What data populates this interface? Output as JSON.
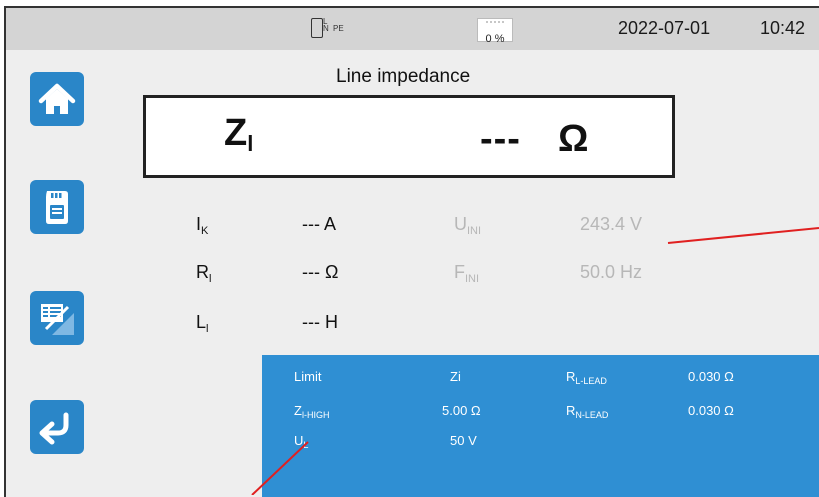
{
  "status_bar": {
    "socket_icon": "socket-l-n-pe-icon",
    "socket_letters": [
      "L",
      "N"
    ],
    "socket_pe": "PE",
    "battery_icon": "battery-icon",
    "battery_level": "0 %",
    "date": "2022-07-01",
    "time": "10:42"
  },
  "nav": {
    "home_icon": "home-icon",
    "memory_icon": "sd-card-icon",
    "report_icon": "report-icon",
    "back_icon": "back-arrow-icon"
  },
  "main": {
    "title": "Line impedance",
    "result": {
      "symbol": "Z",
      "symbol_sub": "l",
      "value": "---",
      "unit": "Ω"
    },
    "measurements": [
      {
        "symbol": "I",
        "sub": "K",
        "value": "--- A"
      },
      {
        "symbol": "R",
        "sub": "l",
        "value": "--- Ω"
      },
      {
        "symbol": "L",
        "sub": "l",
        "value": "--- H"
      }
    ],
    "initial": [
      {
        "symbol": "U",
        "sub": "INI",
        "value": "243.4 V"
      },
      {
        "symbol": "F",
        "sub": "INI",
        "value": "50.0 Hz"
      }
    ]
  },
  "limits": {
    "row1": {
      "label": "Limit",
      "value": "Zi",
      "rlabel": "R",
      "rsub": "L-LEAD",
      "rvalue": "0.030 Ω"
    },
    "row2": {
      "label": "Z",
      "label_sub": "l-HIGH",
      "value": "5.00 Ω",
      "rlabel": "R",
      "rsub": "N-LEAD",
      "rvalue": "0.030 Ω"
    },
    "row3": {
      "label": "U",
      "label_sub": "L",
      "value": "50 V"
    }
  },
  "colors": {
    "accent": "#2a86c8",
    "limits_panel": "#2f8fd3",
    "callout": "#e02020"
  }
}
